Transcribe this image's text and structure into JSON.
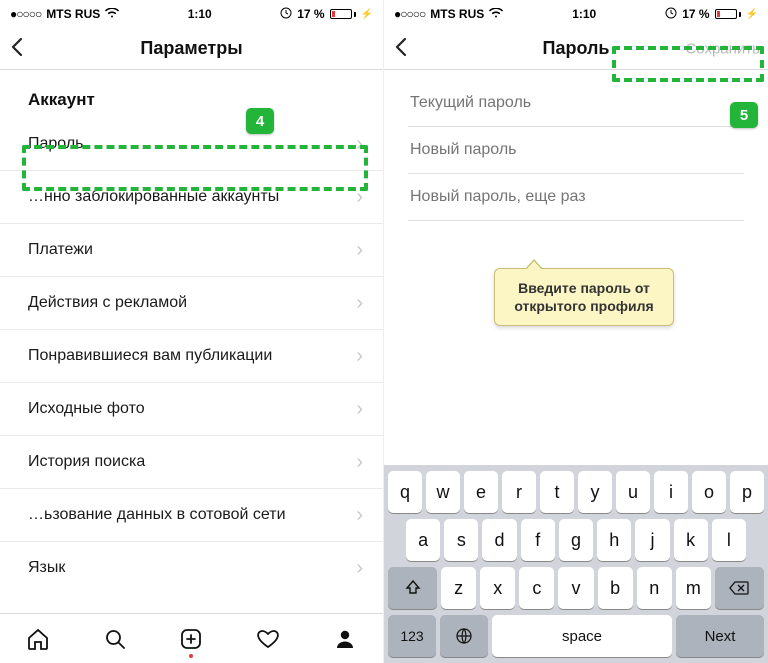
{
  "statusbar": {
    "carrier": "MTS RUS",
    "time": "1:10",
    "battery_pct": "17 %",
    "signal_dots": "●○○○○"
  },
  "left": {
    "header_title": "Параметры",
    "section": "Аккаунт",
    "rows": [
      "Пароль",
      "…нно заблокированные аккаунты",
      "Платежи",
      "Действия с рекламой",
      "Понравившиеся вам публикации",
      "Исходные фото",
      "История поиска",
      "…ьзование данных в сотовой сети",
      "Язык"
    ]
  },
  "right": {
    "header_title": "Пароль",
    "save_label": "Сохранить",
    "fields": {
      "current": "Текущий пароль",
      "new": "Новый пароль",
      "repeat": "Новый пароль, еще раз"
    },
    "callout_line1": "Введите пароль от",
    "callout_line2": "открытого профиля"
  },
  "keyboard": {
    "row1": [
      "q",
      "w",
      "e",
      "r",
      "t",
      "y",
      "u",
      "i",
      "o",
      "p"
    ],
    "row2": [
      "a",
      "s",
      "d",
      "f",
      "g",
      "h",
      "j",
      "k",
      "l"
    ],
    "row3": [
      "z",
      "x",
      "c",
      "v",
      "b",
      "n",
      "m"
    ],
    "num": "123",
    "space": "space",
    "next": "Next"
  },
  "steps": {
    "s4": "4",
    "s5": "5"
  }
}
